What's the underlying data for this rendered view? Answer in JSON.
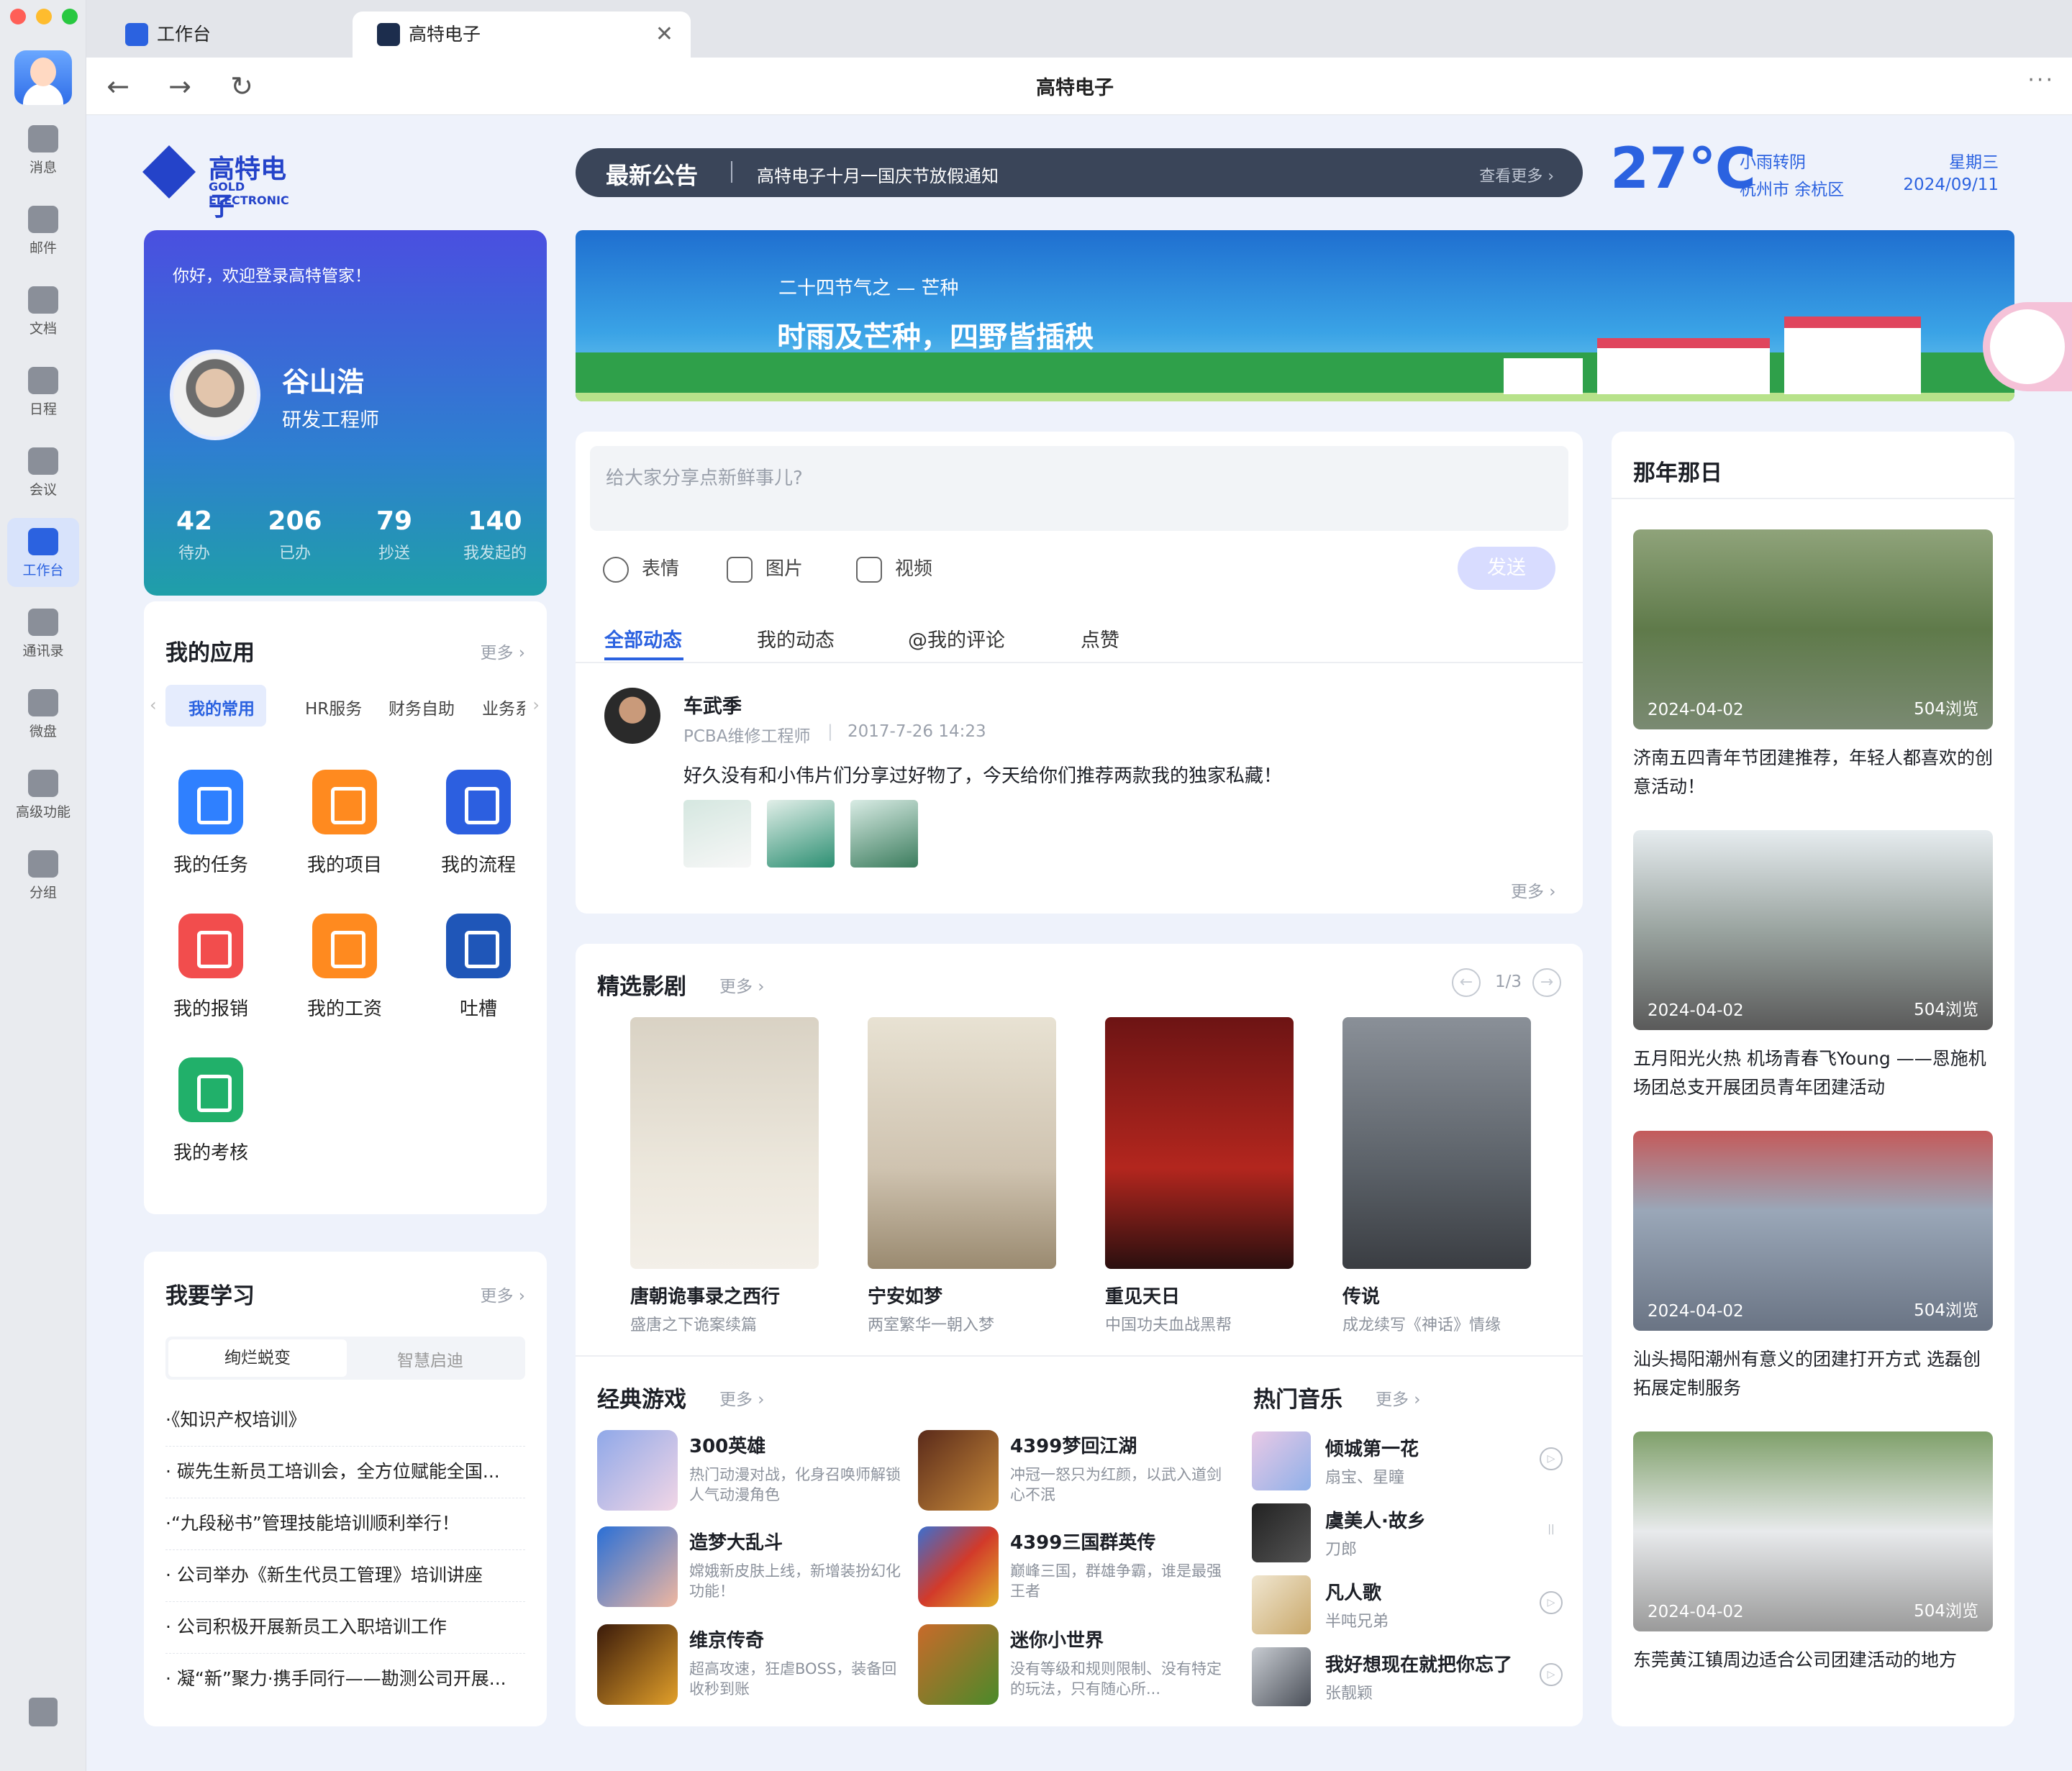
{
  "sidebar": {
    "items": [
      {
        "label": "消息",
        "icon": "message-icon"
      },
      {
        "label": "邮件",
        "icon": "mail-icon"
      },
      {
        "label": "文档",
        "icon": "document-icon"
      },
      {
        "label": "日程",
        "icon": "calendar-icon"
      },
      {
        "label": "会议",
        "icon": "meeting-icon"
      },
      {
        "label": "工作台",
        "icon": "workbench-icon"
      },
      {
        "label": "通讯录",
        "icon": "contacts-icon"
      },
      {
        "label": "微盘",
        "icon": "cloud-drive-icon"
      },
      {
        "label": "高级功能",
        "icon": "advanced-icon"
      },
      {
        "label": "分组",
        "icon": "group-icon"
      }
    ]
  },
  "tabs": [
    {
      "label": "工作台"
    },
    {
      "label": "高特电子"
    }
  ],
  "address": {
    "title": "高特电子"
  },
  "logo": {
    "cn": "高特电子",
    "en": "GOLD ELECTRONIC"
  },
  "notice": {
    "badge": "最新公告",
    "text": "高特电子十月一国庆节放假通知",
    "more": "查看更多 ›"
  },
  "weather": {
    "temp": "27℃",
    "condition": "小雨转阴",
    "location": "杭州市 余杭区",
    "weekday": "星期三",
    "date": "2024/09/11"
  },
  "banner": {
    "subtitle": "二十四节气之 — 芒种",
    "title": "时雨及芒种，四野皆插秧"
  },
  "profile": {
    "greeting": "你好，欢迎登录高特管家！",
    "name": "谷山浩",
    "role": "研发工程师",
    "stats": [
      {
        "value": "42",
        "label": "待办"
      },
      {
        "value": "206",
        "label": "已办"
      },
      {
        "value": "79",
        "label": "抄送"
      },
      {
        "value": "140",
        "label": "我发起的"
      }
    ]
  },
  "apps": {
    "title": "我的应用",
    "more": "更多 ›",
    "tabs": [
      "我的常用",
      "HR服务",
      "财务自助",
      "业务系"
    ],
    "items": [
      {
        "label": "我的任务",
        "icon": "task-icon",
        "color": "#2f80ff"
      },
      {
        "label": "我的项目",
        "icon": "project-icon",
        "color": "#ff8a1f"
      },
      {
        "label": "我的流程",
        "icon": "flow-icon",
        "color": "#2c5fe0"
      },
      {
        "label": "我的报销",
        "icon": "reimburse-icon",
        "color": "#f24d4d"
      },
      {
        "label": "我的工资",
        "icon": "salary-icon",
        "color": "#ff8a1f"
      },
      {
        "label": "吐槽",
        "icon": "feedback-icon",
        "color": "#1f56b8"
      },
      {
        "label": "我的考核",
        "icon": "assessment-icon",
        "color": "#21b06a"
      }
    ]
  },
  "learning": {
    "title": "我要学习",
    "more": "更多 ›",
    "tabs": [
      "绚烂蜕变",
      "智慧启迪"
    ],
    "items": [
      "·《知识产权培训》",
      "· 碳先生新员工培训会，全方位赋能全国...",
      "·“九段秘书”管理技能培训顺利举行！",
      "· 公司举办《新生代员工管理》培训讲座",
      "· 公司积极开展新员工入职培训工作",
      "· 凝“新”聚力·携手同行——勘测公司开展..."
    ]
  },
  "composer": {
    "placeholder": "给大家分享点新鲜事儿?",
    "tools": [
      "表情",
      "图片",
      "视频"
    ],
    "send": "发送"
  },
  "feed": {
    "tabs": [
      "全部动态",
      "我的动态",
      "@我的评论",
      "点赞"
    ],
    "post": {
      "author": "车武季",
      "meta_role": "PCBA维修工程师",
      "meta_time": "2017-7-26 14:23",
      "content": "好久没有和小伟片们分享过好物了，今天给你们推荐两款我的独家私藏！"
    },
    "more": "更多 ›"
  },
  "movies": {
    "title": "精选影剧",
    "more": "更多 ›",
    "pager": "1/3",
    "items": [
      {
        "title": "唐朝诡事录之西行",
        "sub": "盛唐之下诡案续篇"
      },
      {
        "title": "宁安如梦",
        "sub": "两室繁华一朝入梦"
      },
      {
        "title": "重见天日",
        "sub": "中国功夫血战黑帮"
      },
      {
        "title": "传说",
        "sub": "成龙续写《神话》情缘"
      }
    ]
  },
  "games": {
    "title": "经典游戏",
    "more": "更多 ›",
    "items": [
      {
        "title": "300英雄",
        "desc": "热门动漫对战，化身召唤师解锁人气动漫角色"
      },
      {
        "title": "4399梦回江湖",
        "desc": "冲冠一怒只为红颜，以武入道剑心不泯"
      },
      {
        "title": "造梦大乱斗",
        "desc": "嫦娥新皮肤上线，新增装扮幻化功能！"
      },
      {
        "title": "4399三国群英传",
        "desc": "巅峰三国，群雄争霸，谁是最强王者"
      },
      {
        "title": "维京传奇",
        "desc": "超高攻速，狂虐BOSS，装备回收秒到账"
      },
      {
        "title": "迷你小世界",
        "desc": "没有等级和规则限制、没有特定的玩法，只有随心所..."
      }
    ]
  },
  "music": {
    "title": "热门音乐",
    "more": "更多 ›",
    "items": [
      {
        "title": "倾城第一花",
        "artist": "扇宝、星瞳",
        "state": "▷"
      },
      {
        "title": "虞美人·故乡",
        "artist": "刀郎",
        "state": "||"
      },
      {
        "title": "凡人歌",
        "artist": "半吨兄弟",
        "state": "▷"
      },
      {
        "title": "我好想现在就把你忘了",
        "artist": "张靓颖",
        "state": "▷"
      }
    ]
  },
  "memory": {
    "title": "那年那日",
    "items": [
      {
        "date": "2024-04-02",
        "views": "504浏览",
        "text": "济南五四青年节团建推荐，年轻人都喜欢的创意活动！"
      },
      {
        "date": "2024-04-02",
        "views": "504浏览",
        "text": "五月阳光火热 机场青春飞Young ——恩施机场团总支开展团员青年团建活动"
      },
      {
        "date": "2024-04-02",
        "views": "504浏览",
        "text": "汕头揭阳潮州有意义的团建打开方式 选磊创拓展定制服务"
      },
      {
        "date": "2024-04-02",
        "views": "504浏览",
        "text": "东莞黄江镇周边适合公司团建活动的地方"
      }
    ]
  },
  "colors": {
    "accent": "#2b62e0",
    "notice_bg": "#3a4559",
    "banner_top": "#1e6fd0"
  }
}
